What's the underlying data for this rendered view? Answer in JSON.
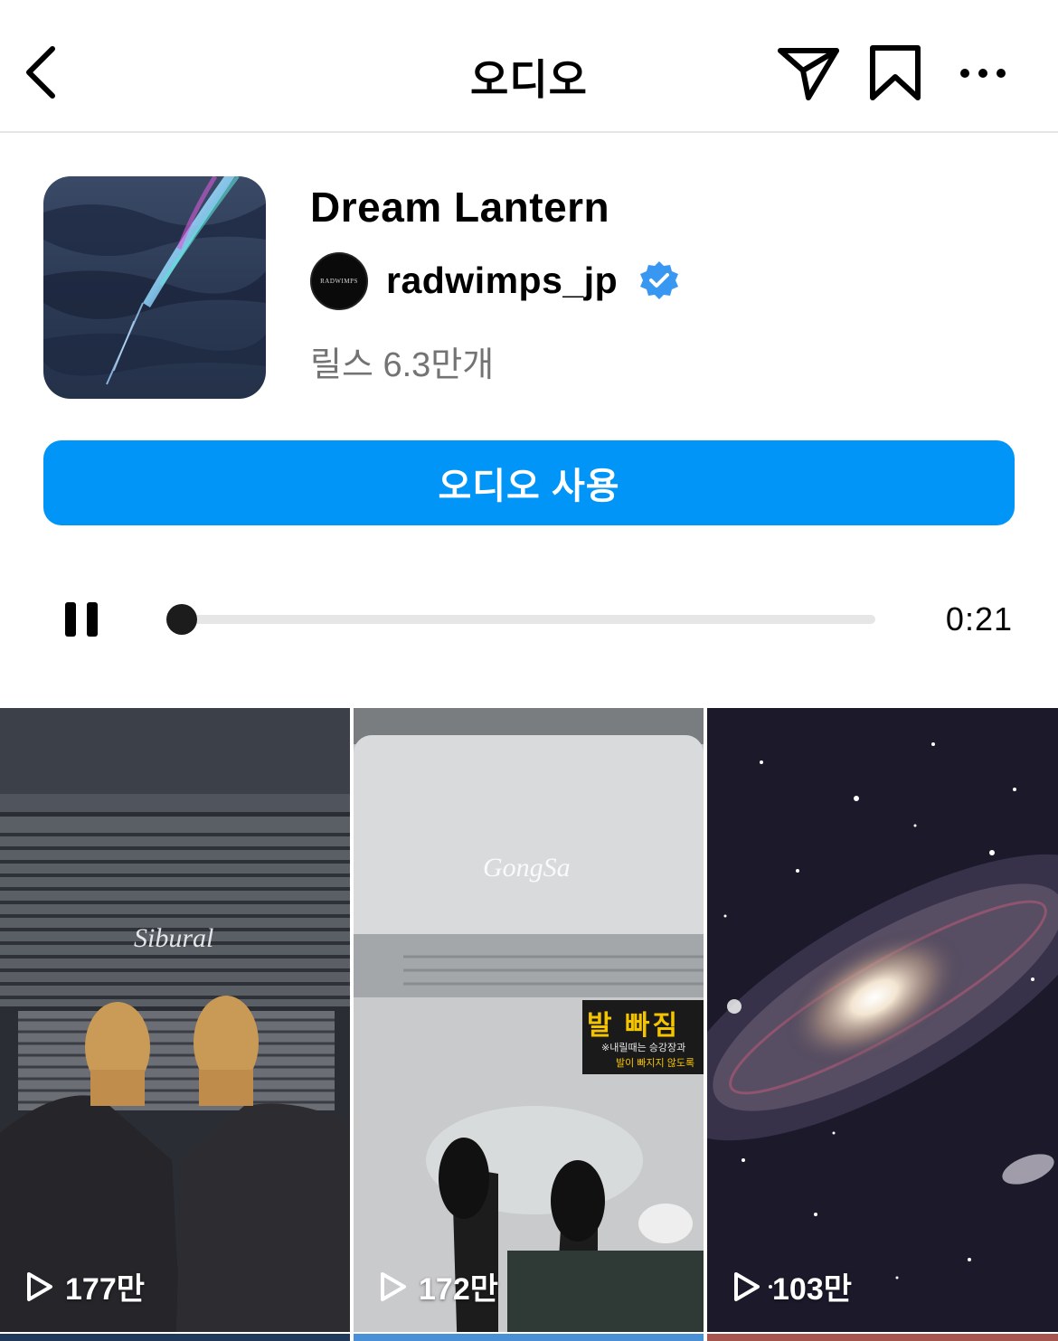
{
  "header": {
    "title": "오디오",
    "icons": [
      "chevron-left-icon",
      "send-icon",
      "bookmark-icon",
      "more-icon"
    ]
  },
  "audio": {
    "title": "Dream Lantern",
    "artist": "radwimps_jp",
    "artist_avatar_text": "RADWIMPS",
    "verified": true,
    "reels_count": "릴스 6.3만개"
  },
  "use_audio_button": "오디오 사용",
  "player": {
    "state": "playing",
    "progress": 0.0,
    "time": "0:21"
  },
  "reels": [
    {
      "watermark": "Sibural",
      "views": "177만"
    },
    {
      "watermark": "GongSa",
      "views": "172만",
      "sign_title": "발 빠짐",
      "sign_line1": "※내릴때는 승강장과",
      "sign_line2": "발이 빠지지 않도록"
    },
    {
      "watermark": "",
      "views": "103만"
    }
  ],
  "colors": {
    "accent": "#0095f6",
    "verified": "#3897f0",
    "muted_text": "#737373"
  }
}
